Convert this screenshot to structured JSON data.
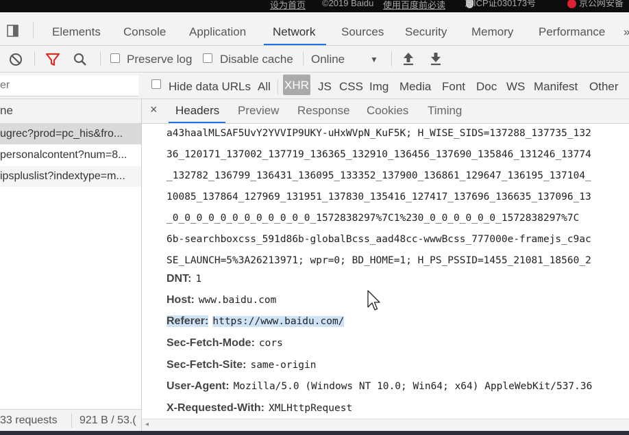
{
  "top_strip": {
    "set_homepage": "设为首页",
    "copyright": "©2019 Baidu",
    "must_read": "使用百度前必读",
    "icp": "京ICP证030173号",
    "police": "京公网安备"
  },
  "tabs": [
    "Elements",
    "Console",
    "Application",
    "Network",
    "Sources",
    "Security",
    "Memory",
    "Performance"
  ],
  "active_tab": "Network",
  "toolbar": {
    "preserve_log": "Preserve log",
    "disable_cache": "Disable cache",
    "throttle": "Online",
    "throttle_arrow": "▼",
    "upload_icon": "⇧",
    "download_icon": "⇩"
  },
  "filter": {
    "placeholder": "er",
    "hide_data_urls": "Hide data URLs",
    "types": [
      "All",
      "XHR",
      "JS",
      "CSS",
      "Img",
      "Media",
      "Font",
      "Doc",
      "WS",
      "Manifest",
      "Other"
    ],
    "selected": "XHR"
  },
  "request_list": {
    "column_header": "ne",
    "items": [
      "ugrec?prod=pc_his&fro...",
      "personalcontent?num=8...",
      "ipspluslist?indextype=m..."
    ],
    "status_requests": "33 requests",
    "status_size": "921 B / 53.("
  },
  "detail_tabs": {
    "close": "×",
    "items": [
      "Headers",
      "Preview",
      "Response",
      "Cookies",
      "Timing"
    ],
    "active": "Headers"
  },
  "cookie_lines": [
    "a43haalMLSAF5UvY2YVVIP9UKY-uHxWVpN_KuF5K; H_WISE_SIDS=137288_137735_132",
    "36_120171_137002_137719_136365_132910_136456_137690_135846_131246_13774",
    "_132782_136799_136431_136095_133352_137900_136861_129647_136195_137104_",
    "10085_137864_127969_131951_137830_135416_127417_137696_136635_137096_13",
    "_0_0_0_0_0_0_0_0_0_0_0_0_1572838297%7C1%230_0_0_0_0_0_0_1572838297%7C",
    "6b-searchboxcss_591d86b-globalBcss_aad48cc-wwwBcss_777000e-framejs_c9ac",
    "SE_LAUNCH=5%3A26213971; wpr=0; BD_HOME=1; H_PS_PSSID=1455_21081_18560_2"
  ],
  "headers": [
    {
      "key": "DNT:",
      "value": "1"
    },
    {
      "key": "Host:",
      "value": "www.baidu.com"
    },
    {
      "key": "Referer:",
      "value": "https://www.baidu.com/"
    },
    {
      "key": "Sec-Fetch-Mode:",
      "value": "cors"
    },
    {
      "key": "Sec-Fetch-Site:",
      "value": "same-origin"
    },
    {
      "key": "User-Agent:",
      "value": "Mozilla/5.0 (Windows NT 10.0; Win64; x64) AppleWebKit/537.36"
    },
    {
      "key": "X-Requested-With:",
      "value": "XMLHttpRequest"
    }
  ],
  "colors": {
    "accent": "#1a73e8",
    "record_red": "#d93025",
    "highlight": "#cfe3f7"
  }
}
